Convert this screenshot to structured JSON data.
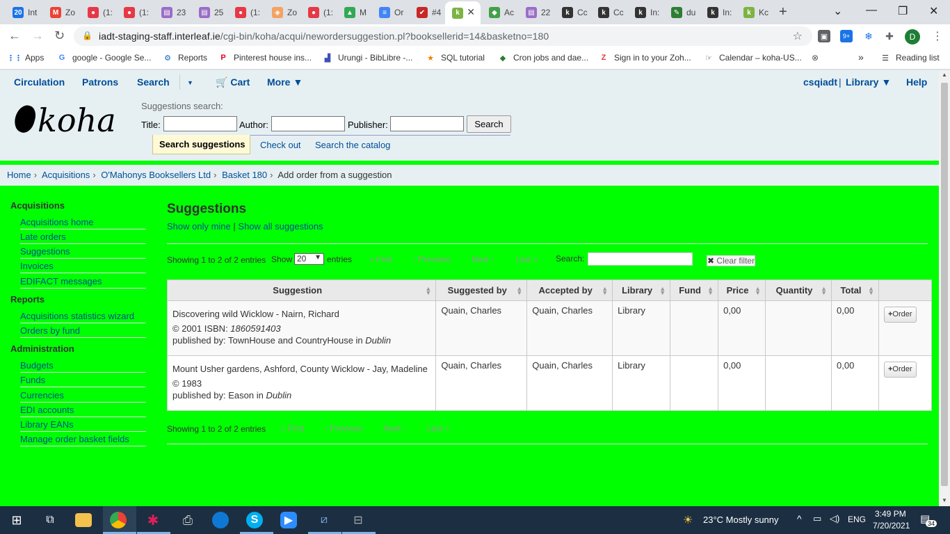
{
  "browser": {
    "tabs": [
      {
        "label": "Int",
        "icon": "20",
        "color": "#1a73e8"
      },
      {
        "label": "Zo",
        "icon": "M",
        "color": "#ea4335"
      },
      {
        "label": "(1:",
        "icon": "●",
        "color": "#e63946"
      },
      {
        "label": "(1:",
        "icon": "●",
        "color": "#e63946"
      },
      {
        "label": "23",
        "icon": "▤",
        "color": "#9b6dc6"
      },
      {
        "label": "25",
        "icon": "▤",
        "color": "#9b6dc6"
      },
      {
        "label": "(1:",
        "icon": "●",
        "color": "#e63946"
      },
      {
        "label": "Zo",
        "icon": "◈",
        "color": "#f4a261"
      },
      {
        "label": "(1:",
        "icon": "●",
        "color": "#e63946"
      },
      {
        "label": "M",
        "icon": "▲",
        "color": "#34a853"
      },
      {
        "label": "Or",
        "icon": "≡",
        "color": "#4285f4"
      },
      {
        "label": "#4",
        "icon": "✔",
        "color": "#c62828"
      },
      {
        "label": "",
        "icon": "k",
        "color": "#7cb342"
      },
      {
        "label": "Ac",
        "icon": "◆",
        "color": "#43a047"
      },
      {
        "label": "22",
        "icon": "▤",
        "color": "#9b6dc6"
      },
      {
        "label": "Cc",
        "icon": "k",
        "color": "#333333"
      },
      {
        "label": "Cc",
        "icon": "k",
        "color": "#333333"
      },
      {
        "label": "In:",
        "icon": "k",
        "color": "#333333"
      },
      {
        "label": "du",
        "icon": "✎",
        "color": "#2e7d32"
      },
      {
        "label": "In:",
        "icon": "k",
        "color": "#333333"
      },
      {
        "label": "Kc",
        "icon": "k",
        "color": "#7cb342"
      }
    ],
    "url_host": "iadt-staging-staff.interleaf.ie",
    "url_path": "/cgi-bin/koha/acqui/newordersuggestion.pl?booksellerid=14&basketno=180",
    "extension_badge": "9+",
    "profile_initial": "D",
    "bookmarks": [
      {
        "label": "Apps",
        "icon": "⋮⋮",
        "color": "#1a73e8"
      },
      {
        "label": "google - Google Se...",
        "icon": "G",
        "color": "#4285f4"
      },
      {
        "label": "Reports",
        "icon": "⚙",
        "color": "#1565c0"
      },
      {
        "label": "Pinterest house ins...",
        "icon": "P",
        "color": "#e60023"
      },
      {
        "label": "Urungi - BibLibre -...",
        "icon": "▟",
        "color": "#3f51b5"
      },
      {
        "label": "SQL tutorial",
        "icon": "★",
        "color": "#f57c00"
      },
      {
        "label": "Cron jobs and dae...",
        "icon": "◆",
        "color": "#2e7d32"
      },
      {
        "label": "Sign in to your Zoh...",
        "icon": "Z",
        "color": "#e53935"
      },
      {
        "label": "Calendar – koha-US...",
        "icon": "☞",
        "color": "#333333"
      }
    ],
    "reading_list": "Reading list",
    "more_bookmarks": "»"
  },
  "koha": {
    "nav": {
      "circulation": "Circulation",
      "patrons": "Patrons",
      "search": "Search",
      "cart": "Cart",
      "more": "More",
      "user": "csqiadt",
      "separator": "|",
      "library": "Library",
      "help": "Help"
    },
    "logo": "koha",
    "search": {
      "label": "Suggestions search:",
      "title_label": "Title:",
      "author_label": "Author:",
      "publisher_label": "Publisher:",
      "button": "Search",
      "tabs": [
        "Search suggestions",
        "Check out",
        "Search the catalog"
      ]
    },
    "breadcrumb": [
      "Home",
      "Acquisitions",
      "O'Mahonys Booksellers Ltd",
      "Basket 180",
      "Add order from a suggestion"
    ],
    "sidebar": {
      "sections": [
        {
          "heading": "Acquisitions",
          "items": [
            "Acquisitions home",
            "Late orders",
            "Suggestions",
            "Invoices",
            "EDIFACT messages"
          ]
        },
        {
          "heading": "Reports",
          "items": [
            "Acquisitions statistics wizard",
            "Orders by fund"
          ]
        },
        {
          "heading": "Administration",
          "items": [
            "Budgets",
            "Funds",
            "Currencies",
            "EDI accounts",
            "Library EANs",
            "Manage order basket fields"
          ]
        }
      ]
    },
    "main": {
      "title": "Suggestions",
      "show_mine": "Show only mine",
      "show_sep": "|",
      "show_all": "Show all suggestions",
      "info": "Showing 1 to 2 of 2 entries",
      "show_label": "Show",
      "page_length": "20",
      "entries_label": "entries",
      "first": "« First",
      "previous": "‹ Previous",
      "next": "Next ›",
      "last": "Last »",
      "search_label": "Search:",
      "clear_filter": "Clear filter",
      "columns": [
        "Suggestion",
        "Suggested by",
        "Accepted by",
        "Library",
        "Fund",
        "Price",
        "Quantity",
        "Total",
        ""
      ],
      "rows": [
        {
          "title": "Discovering wild Wicklow - Nairn, Richard",
          "year_isbn_prefix": "© 2001 ISBN: ",
          "isbn": "1860591403",
          "published_prefix": "published by: TownHouse and CountryHouse in ",
          "place": "Dublin",
          "suggested_by": "Quain, Charles",
          "accepted_by": "Quain, Charles",
          "library": "Library",
          "fund": "",
          "price": "0,00",
          "quantity": "",
          "total": "0,00",
          "order": "Order"
        },
        {
          "title": "Mount Usher gardens, Ashford, County Wicklow - Jay, Madeline",
          "year_isbn_prefix": "© 1983",
          "isbn": "",
          "published_prefix": "published by: Eason in ",
          "place": "Dublin",
          "suggested_by": "Quain, Charles",
          "accepted_by": "Quain, Charles",
          "library": "Library",
          "fund": "",
          "price": "0,00",
          "quantity": "",
          "total": "0,00",
          "order": "Order"
        }
      ]
    }
  },
  "taskbar": {
    "weather": "23°C  Mostly sunny",
    "lang": "ENG",
    "time": "3:49 PM",
    "date": "7/20/2021",
    "notifications": "34"
  }
}
